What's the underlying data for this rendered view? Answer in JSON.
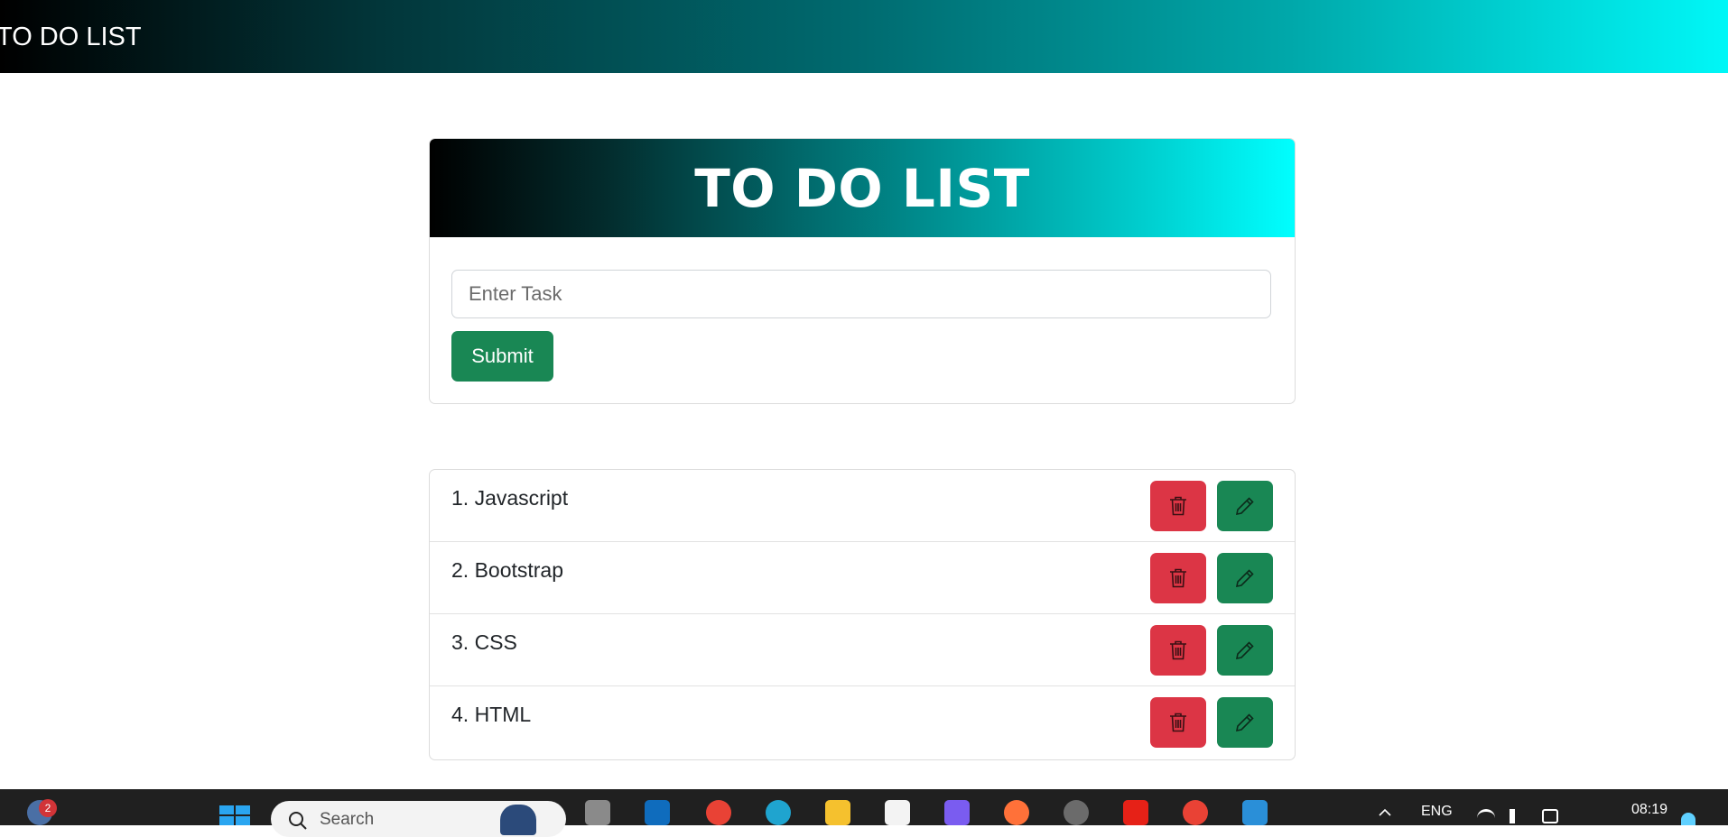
{
  "navbar": {
    "title": "TO DO LIST"
  },
  "card": {
    "title": "TO DO LIST",
    "input_placeholder": "Enter Task",
    "input_value": "",
    "submit_label": "Submit"
  },
  "tasks": [
    {
      "label": "1. Javascript"
    },
    {
      "label": "2. Bootstrap"
    },
    {
      "label": "3. CSS"
    },
    {
      "label": "4. HTML"
    }
  ],
  "icons": {
    "delete": "trash-icon",
    "edit": "pencil-icon"
  },
  "colors": {
    "danger": "#dc3545",
    "success": "#198754",
    "gradient_start": "#000000",
    "gradient_end": "#00ffff"
  },
  "taskbar": {
    "search_label": "Search",
    "notification_count": "2",
    "language": "ENG",
    "time": "08:19"
  }
}
